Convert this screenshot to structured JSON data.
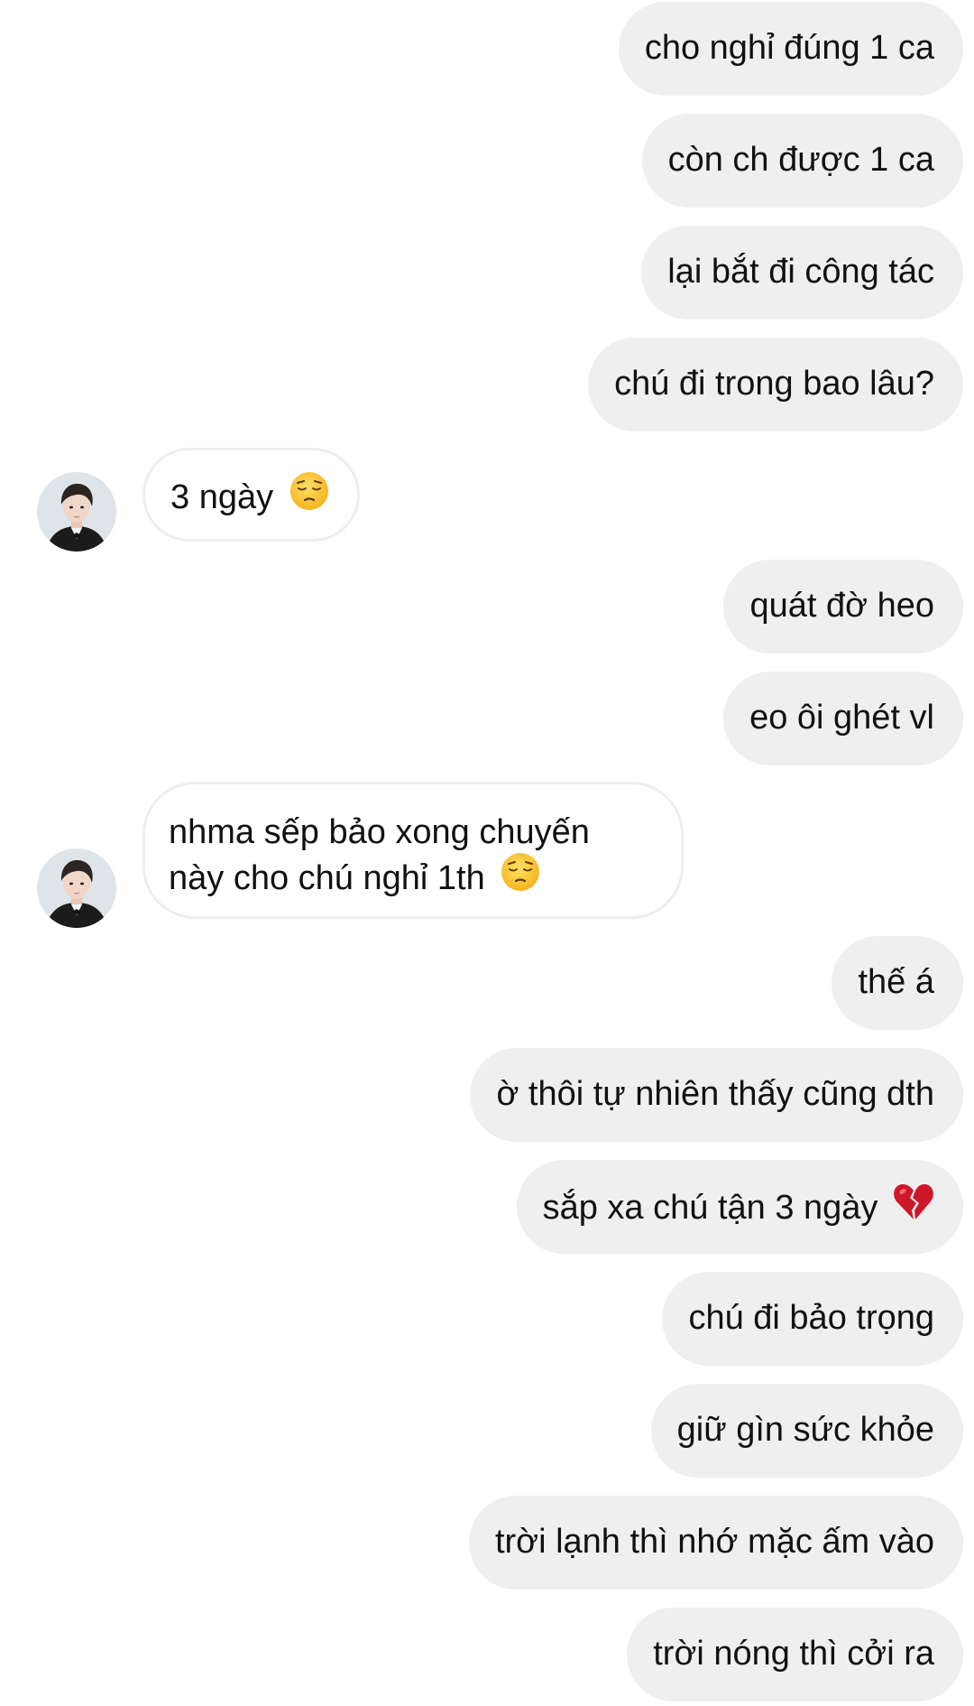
{
  "colors": {
    "outgoing_bubble": "#efefef",
    "incoming_bubble_border": "#eeeeee",
    "text": "#111111",
    "background": "#ffffff"
  },
  "messages": [
    {
      "side": "out",
      "text": "cho nghỉ đúng 1 ca"
    },
    {
      "side": "out",
      "text": "còn ch được 1 ca"
    },
    {
      "side": "out",
      "text": "lại bắt đi công tác"
    },
    {
      "side": "out",
      "text": "chú đi trong bao lâu?"
    },
    {
      "side": "in",
      "text": "3 ngày",
      "emoji": "pensive-face-icon"
    },
    {
      "side": "out",
      "text": "quát đờ heo"
    },
    {
      "side": "out",
      "text": "eo ôi ghét vl"
    },
    {
      "side": "in",
      "line1": "nhma sếp bảo xong chuyến",
      "line2": "này cho chú nghỉ 1th",
      "emoji": "pensive-face-icon"
    },
    {
      "side": "out",
      "text": "thế á"
    },
    {
      "side": "out",
      "text": "ờ thôi tự nhiên thấy cũng dth"
    },
    {
      "side": "out",
      "text": "sắp xa chú tận 3 ngày",
      "emoji": "broken-heart-icon"
    },
    {
      "side": "out",
      "text": "chú đi bảo trọng"
    },
    {
      "side": "out",
      "text": "giữ gìn sức khỏe"
    },
    {
      "side": "out",
      "text": "trời lạnh thì nhớ mặc ấm vào"
    },
    {
      "side": "out",
      "text": "trời nóng thì cởi ra"
    }
  ]
}
